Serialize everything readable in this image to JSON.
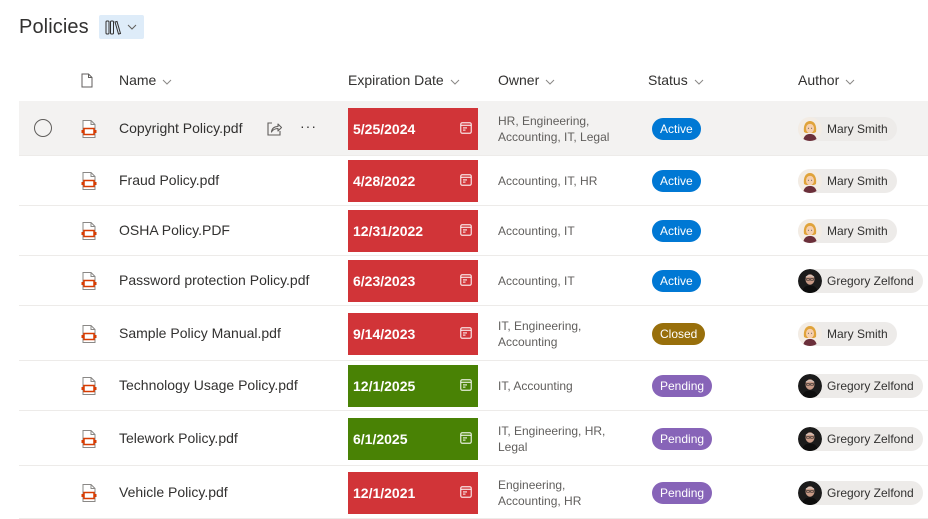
{
  "page": {
    "title": "Policies",
    "view_switch_icon": "library-icon",
    "view_switch_chevron": "chevron-down-icon"
  },
  "columns": {
    "type_icon": "document-icon",
    "name": "Name",
    "expiration_date": "Expiration Date",
    "owner": "Owner",
    "status": "Status",
    "author": "Author"
  },
  "colors": {
    "expired": "#d13438",
    "valid": "#498205",
    "status_active": "#0078d4",
    "status_closed": "#986f0b",
    "status_pending": "#8764b8",
    "selected_row_bg": "#f3f2f1",
    "view_switch_bg": "#deecf9",
    "pdf_icon": "#d83b01"
  },
  "row_actions": {
    "share_icon": "share-icon",
    "more_label": "···"
  },
  "rows": [
    {
      "name": "Copyright Policy.pdf",
      "expiration": "5/25/2024",
      "date_state": "expired",
      "owner": "HR, Engineering, Accounting, IT, Legal",
      "status": "Active",
      "author": "Mary Smith",
      "author_avatar": "mary",
      "selected": true
    },
    {
      "name": "Fraud Policy.pdf",
      "expiration": "4/28/2022",
      "date_state": "expired",
      "owner": "Accounting, IT, HR",
      "status": "Active",
      "author": "Mary Smith",
      "author_avatar": "mary",
      "selected": false
    },
    {
      "name": "OSHA Policy.PDF",
      "expiration": "12/31/2022",
      "date_state": "expired",
      "owner": "Accounting, IT",
      "status": "Active",
      "author": "Mary Smith",
      "author_avatar": "mary",
      "selected": false
    },
    {
      "name": "Password protection Policy.pdf",
      "expiration": "6/23/2023",
      "date_state": "expired",
      "owner": "Accounting, IT",
      "status": "Active",
      "author": "Gregory Zelfond",
      "author_avatar": "gregory",
      "selected": false
    },
    {
      "name": "Sample Policy Manual.pdf",
      "expiration": "9/14/2023",
      "date_state": "expired",
      "owner": "IT, Engineering, Accounting",
      "status": "Closed",
      "author": "Mary Smith",
      "author_avatar": "mary",
      "selected": false
    },
    {
      "name": "Technology Usage Policy.pdf",
      "expiration": "12/1/2025",
      "date_state": "valid",
      "owner": "IT, Accounting",
      "status": "Pending",
      "author": "Gregory Zelfond",
      "author_avatar": "gregory",
      "selected": false
    },
    {
      "name": "Telework Policy.pdf",
      "expiration": "6/1/2025",
      "date_state": "valid",
      "owner": "IT, Engineering, HR, Legal",
      "status": "Pending",
      "author": "Gregory Zelfond",
      "author_avatar": "gregory",
      "selected": false
    },
    {
      "name": "Vehicle Policy.pdf",
      "expiration": "12/1/2021",
      "date_state": "expired",
      "owner": "Engineering, Accounting, HR",
      "status": "Pending",
      "author": "Gregory Zelfond",
      "author_avatar": "gregory",
      "selected": false
    }
  ]
}
